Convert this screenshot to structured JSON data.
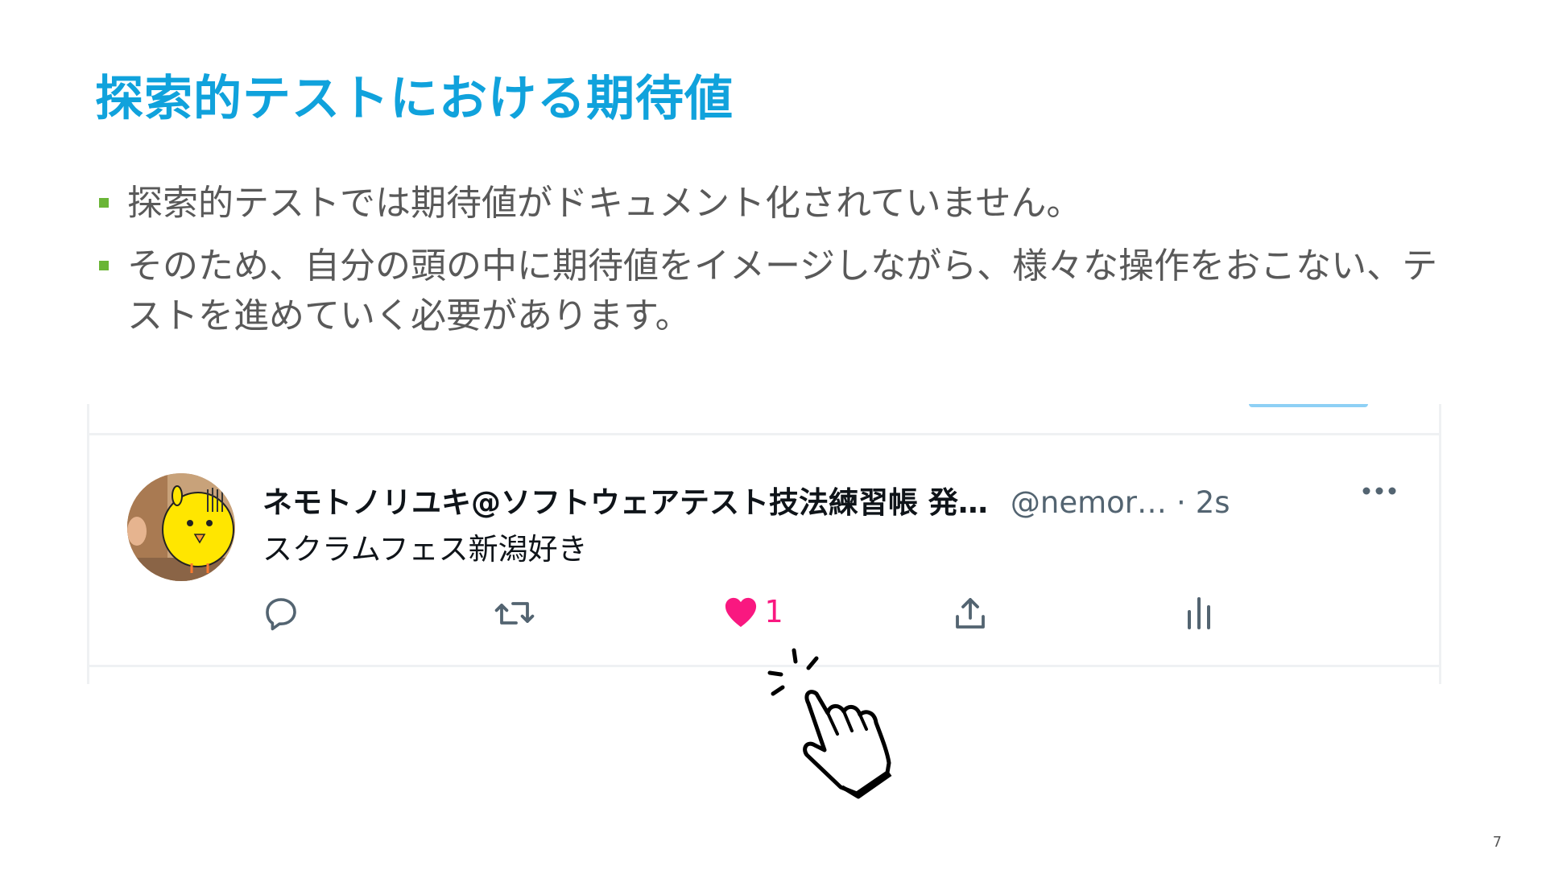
{
  "slide": {
    "title": "探索的テストにおける期待値",
    "bullets": [
      "探索的テストでは期待値がドキュメント化されていません。",
      "そのため、自分の頭の中に期待値をイメージしながら、様々な操作をおこない、テストを進めていく必要があります。"
    ],
    "page_number": "7",
    "title_color": "#10a2dc",
    "bullet_color": "#6ab536"
  },
  "tweet": {
    "display_name": "ネモトノリユキ@ソフトウェアテスト技法練習帳 発…",
    "handle": "@nemor…",
    "separator": "·",
    "time": "2s",
    "text": "スクラムフェス新潟好き",
    "like_count": "1",
    "like_color": "#f91880",
    "icons": [
      "more-icon",
      "reply-icon",
      "retweet-icon",
      "heart-icon",
      "share-icon",
      "analytics-icon"
    ]
  }
}
